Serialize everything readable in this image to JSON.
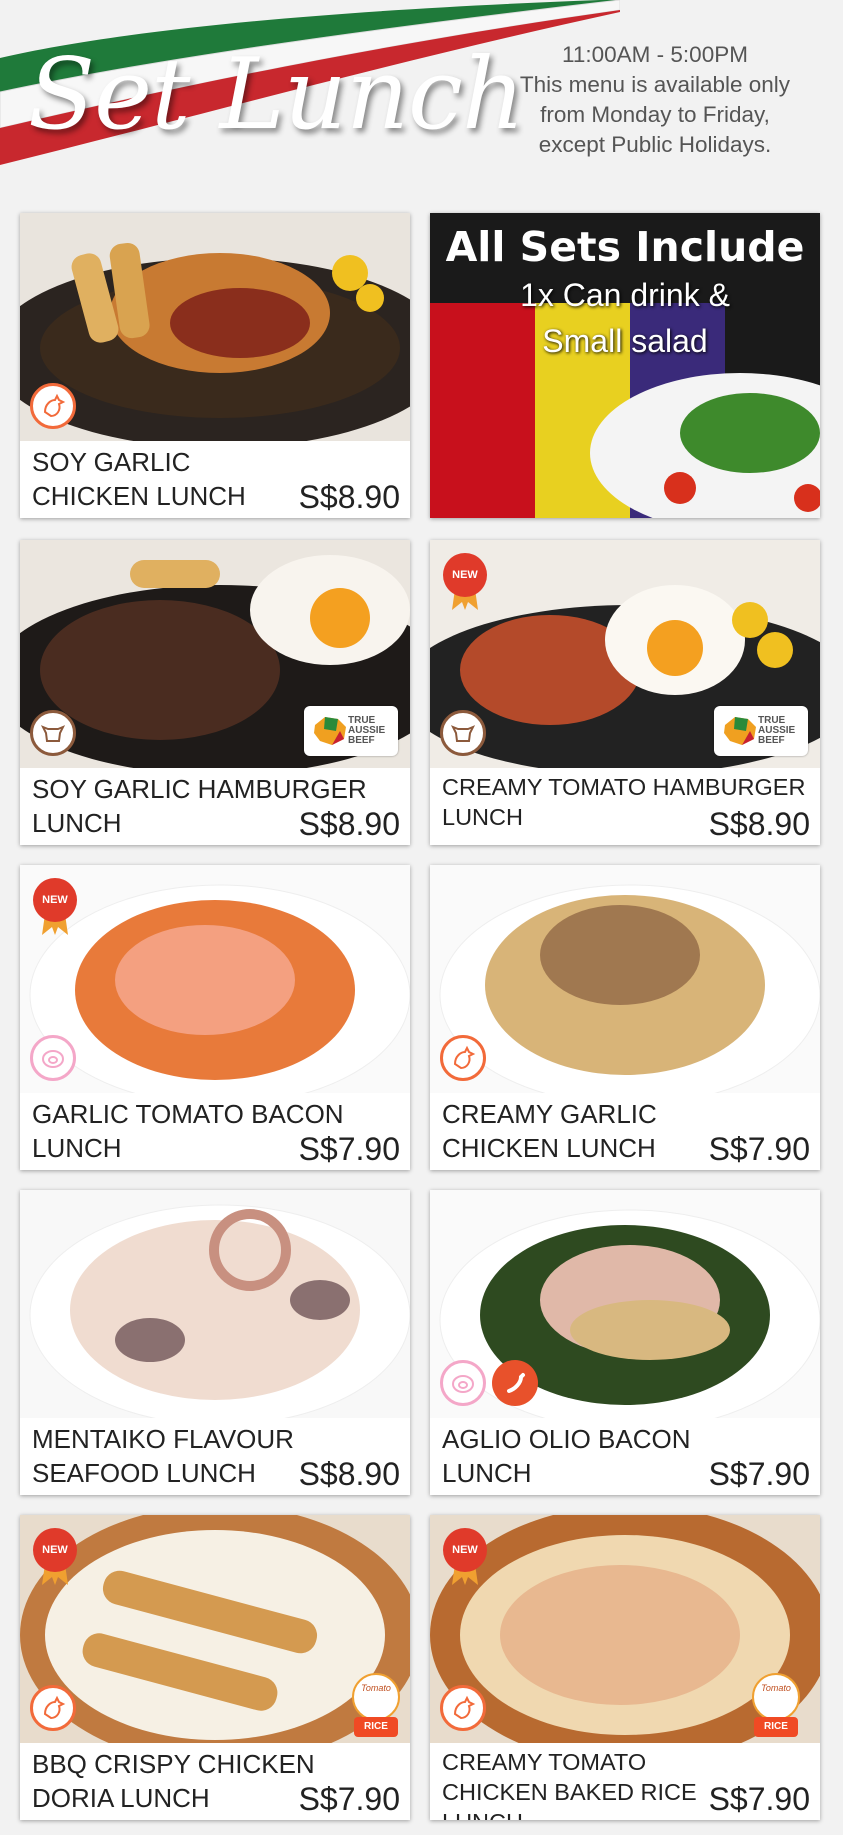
{
  "header": {
    "title": "Set Lunch",
    "hours": "11:00AM - 5:00PM",
    "availability_lines": [
      "This menu is available only",
      "from Monday to Friday,",
      "except Public Holidays."
    ]
  },
  "promo": {
    "title": "All Sets Include",
    "line1": "1x Can drink &",
    "line2": "Small salad"
  },
  "badges": {
    "new": "NEW",
    "aussie": "TRUE AUSSIE BEEF",
    "rice": "RICE",
    "rice_brand": "Tomato"
  },
  "items": [
    {
      "name": "SOY GARLIC CHICKEN LUNCH",
      "price": "S$8.90"
    },
    {
      "name": "SOY GARLIC HAMBURGER LUNCH",
      "price": "S$8.90"
    },
    {
      "name": "CREAMY TOMATO HAMBURGER LUNCH",
      "price": "S$8.90"
    },
    {
      "name": "GARLIC TOMATO BACON LUNCH",
      "price": "S$7.90"
    },
    {
      "name": "CREAMY GARLIC CHICKEN LUNCH",
      "price": "S$7.90"
    },
    {
      "name": "MENTAIKO FLAVOUR SEAFOOD LUNCH",
      "price": "S$8.90"
    },
    {
      "name": "AGLIO OLIO BACON LUNCH",
      "price": "S$7.90"
    },
    {
      "name": "BBQ CRISPY CHICKEN DORIA LUNCH",
      "price": "S$7.90"
    },
    {
      "name": "CREAMY TOMATO CHICKEN BAKED RICE LUNCH",
      "price": "S$7.90"
    }
  ],
  "colors": {
    "ribbon_green": "#1f7a3a",
    "ribbon_red": "#c8282e",
    "badge_chicken": "#f26a3a",
    "badge_pig": "#f4a7c8",
    "new_badge": "#e03a2a"
  }
}
